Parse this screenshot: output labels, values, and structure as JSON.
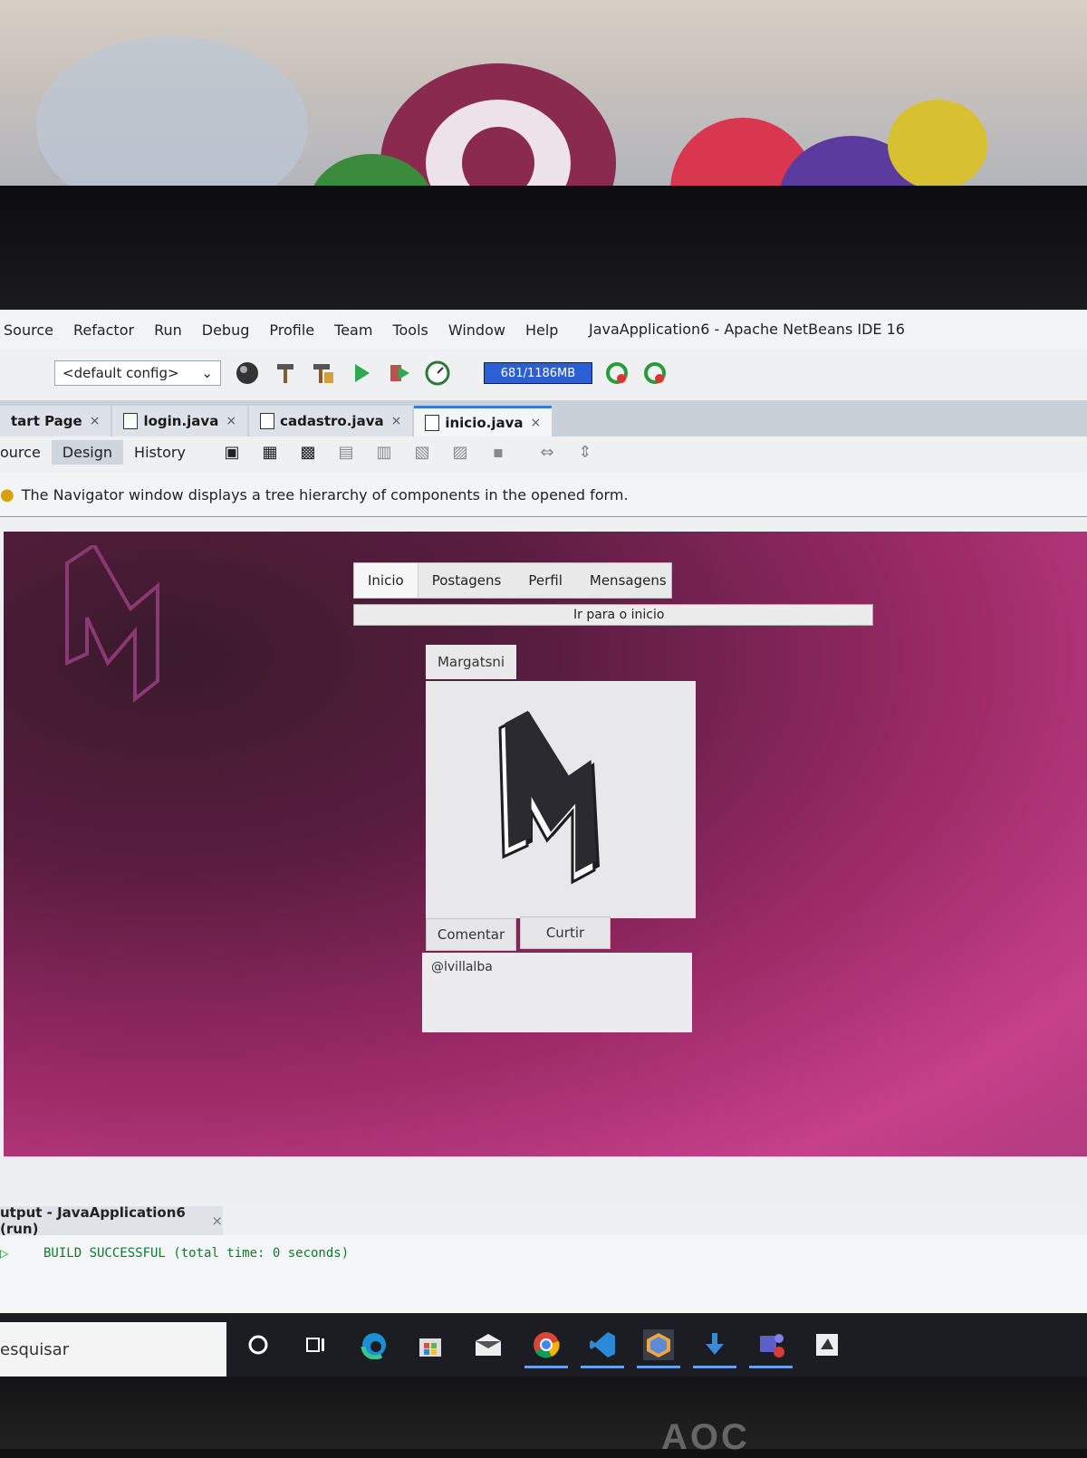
{
  "ide": {
    "window_title": "JavaApplication6 - Apache NetBeans IDE 16",
    "menu": [
      "Source",
      "Refactor",
      "Run",
      "Debug",
      "Profile",
      "Team",
      "Tools",
      "Window",
      "Help"
    ],
    "config_value": "<default config>",
    "memory": "681/1186MB",
    "tabs": [
      {
        "label": "tart Page"
      },
      {
        "label": "login.java"
      },
      {
        "label": "cadastro.java"
      },
      {
        "label": "inicio.java"
      }
    ],
    "close_glyph": "×",
    "view_modes": [
      "ource",
      "Design",
      "History"
    ],
    "info_text": "The Navigator window displays a tree hierarchy of components in the opened form."
  },
  "form": {
    "nav_tabs": [
      "Inicio",
      "Postagens",
      "Perfil",
      "Mensagens"
    ],
    "goto_label": "Ir para o inicio",
    "user_tab": "Margatsni",
    "comment_button": "Comentar",
    "like_button": "Curtir",
    "comment_text": "@lvillalba",
    "logo_letter": "M"
  },
  "output": {
    "tab_label": "utput - JavaApplication6 (run)",
    "build_line": "BUILD SUCCESSFUL (total time: 0 seconds)"
  },
  "taskbar": {
    "search_placeholder": "esquisar",
    "icons": [
      "cortana-icon",
      "task-view-icon",
      "edge-icon",
      "store-icon",
      "mail-icon",
      "chrome-icon",
      "vscode-icon",
      "netbeans-icon",
      "download-icon",
      "teams-icon",
      "app-icon"
    ]
  },
  "monitor": {
    "brand": "AOC"
  },
  "colors": {
    "canvas_dark": "#3a1a2c",
    "canvas_pink": "#c6408a",
    "memory_bar": "#2c5fd6",
    "active_tab_accent": "#3a78d8",
    "build_green": "#117a2b"
  }
}
